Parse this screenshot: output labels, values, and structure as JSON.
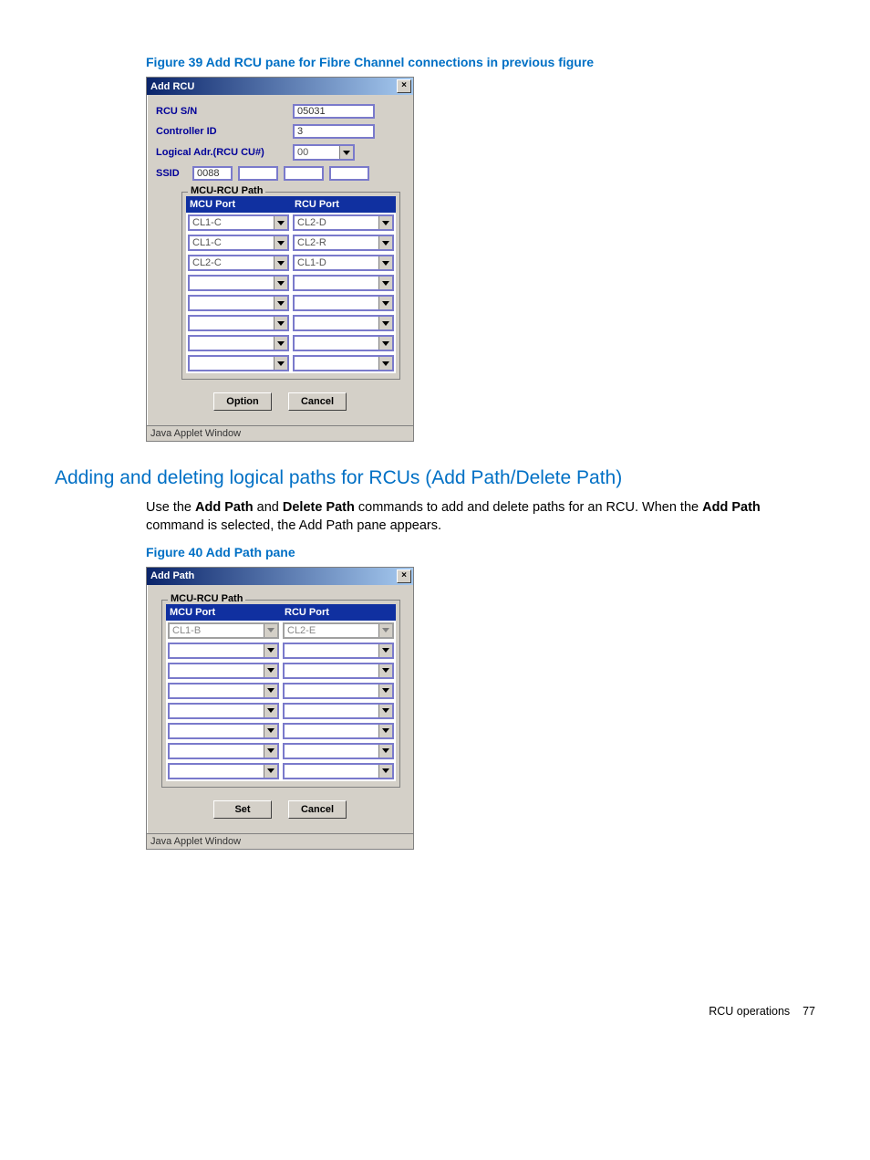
{
  "figure39": {
    "caption": "Figure 39 Add RCU pane for Fibre Channel connections in previous figure",
    "title": "Add RCU",
    "labels": {
      "rcu_sn": "RCU S/N",
      "controller_id": "Controller ID",
      "logical_adr": "Logical Adr.(RCU CU#)",
      "ssid": "SSID"
    },
    "values": {
      "rcu_sn": "05031",
      "controller_id": "3",
      "logical_adr": "00",
      "ssid": [
        "0088",
        "",
        "",
        ""
      ]
    },
    "path_legend": "MCU-RCU Path",
    "path_headers": {
      "mcu": "MCU Port",
      "rcu": "RCU Port"
    },
    "path_rows": [
      {
        "mcu": "CL1-C",
        "rcu": "CL2-D"
      },
      {
        "mcu": "CL1-C",
        "rcu": "CL2-R"
      },
      {
        "mcu": "CL2-C",
        "rcu": "CL1-D"
      },
      {
        "mcu": "",
        "rcu": ""
      },
      {
        "mcu": "",
        "rcu": ""
      },
      {
        "mcu": "",
        "rcu": ""
      },
      {
        "mcu": "",
        "rcu": ""
      },
      {
        "mcu": "",
        "rcu": ""
      }
    ],
    "buttons": {
      "option": "Option",
      "cancel": "Cancel"
    },
    "status": "Java Applet Window"
  },
  "section_heading": "Adding and deleting logical paths for RCUs (Add Path/Delete Path)",
  "body": {
    "part1": "Use the ",
    "bold1": "Add Path",
    "part2": " and ",
    "bold2": "Delete Path",
    "part3": " commands to add and delete paths for an RCU. When the ",
    "bold3": "Add Path",
    "part4": " command is selected, the Add Path pane appears."
  },
  "figure40": {
    "caption": "Figure 40 Add Path pane",
    "title": "Add Path",
    "path_legend": "MCU-RCU Path",
    "path_headers": {
      "mcu": "MCU Port",
      "rcu": "RCU Port"
    },
    "path_rows": [
      {
        "mcu": "CL1-B",
        "rcu": "CL2-E",
        "disabled": true
      },
      {
        "mcu": "",
        "rcu": ""
      },
      {
        "mcu": "",
        "rcu": ""
      },
      {
        "mcu": "",
        "rcu": ""
      },
      {
        "mcu": "",
        "rcu": ""
      },
      {
        "mcu": "",
        "rcu": ""
      },
      {
        "mcu": "",
        "rcu": ""
      },
      {
        "mcu": "",
        "rcu": ""
      }
    ],
    "buttons": {
      "set": "Set",
      "cancel": "Cancel"
    },
    "status": "Java Applet Window"
  },
  "footer": {
    "section": "RCU operations",
    "page": "77"
  }
}
